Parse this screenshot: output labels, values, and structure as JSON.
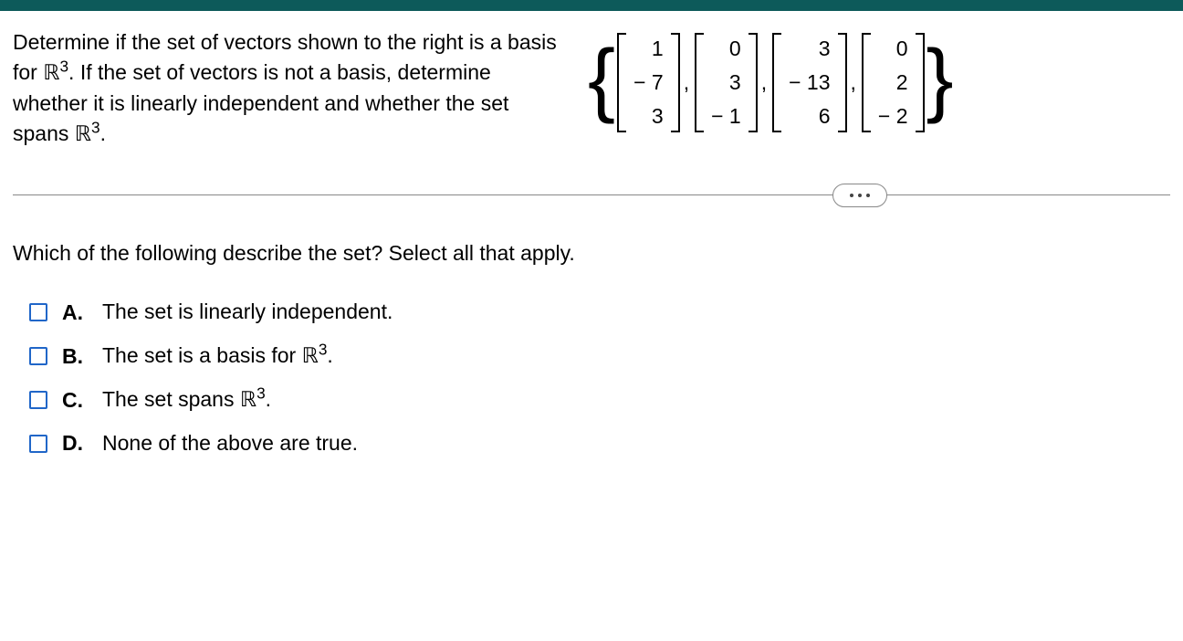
{
  "prompt": {
    "p1a": "Determine if the set of vectors shown to the right is a basis for ",
    "r3_a": "ℝ",
    "exp_a": "3",
    "p1b": ". If the set of vectors is not a basis, determine whether it is linearly independent and whether the set spans ",
    "r3_b": "ℝ",
    "exp_b": "3",
    "p1c": "."
  },
  "vectors": {
    "v1": [
      "1",
      "− 7",
      "3"
    ],
    "v2": [
      "0",
      "3",
      "− 1"
    ],
    "v3": [
      "3",
      "− 13",
      "6"
    ],
    "v4": [
      "0",
      "2",
      "− 2"
    ]
  },
  "comma": ",",
  "question": "Which of the following describe the set? Select all that apply.",
  "options": {
    "a": {
      "letter": "A.",
      "text": "The set is linearly independent."
    },
    "b": {
      "letter": "B.",
      "pre": "The set is a basis for ",
      "r": "ℝ",
      "exp": "3",
      "post": "."
    },
    "c": {
      "letter": "C.",
      "pre": "The set spans ",
      "r": "ℝ",
      "exp": "3",
      "post": "."
    },
    "d": {
      "letter": "D.",
      "text": "None of the above are true."
    }
  }
}
